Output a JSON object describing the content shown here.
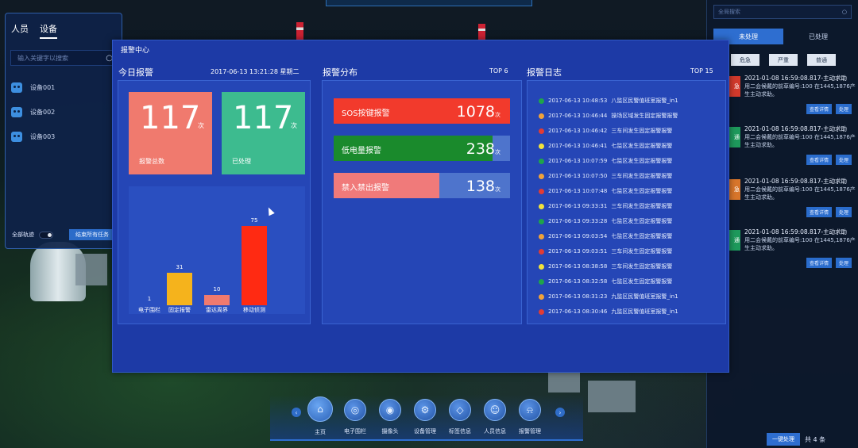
{
  "left_panel": {
    "tabs": [
      "人员",
      "设备"
    ],
    "search_placeholder": "输入关键字以搜索",
    "devices": [
      "设备001",
      "设备002",
      "设备003"
    ],
    "toggle_label": "全部轨迹",
    "end_task_btn": "结束所有任务"
  },
  "right_panel": {
    "search_placeholder": "全局搜索",
    "tabs": [
      "未处理",
      "已处理"
    ],
    "filters": [
      "危急",
      "严重",
      "普通"
    ],
    "items": [
      {
        "badge": "急",
        "badge_color": "#d33a2c",
        "title": "2021-01-08 16:59:08.817-主动求助",
        "desc1": "用二会候戴的前草编号:100 在1445,1876产",
        "desc2": "生主动求助。",
        "btn_detail": "查看详情",
        "btn_handle": "处理"
      },
      {
        "badge": "通",
        "badge_color": "#1e9a5c",
        "title": "2021-01-08 16:59:08.817-主动求助",
        "desc1": "用二会候戴的前草编号:100 在1445,1876产",
        "desc2": "生主动求助。",
        "btn_detail": "查看详情",
        "btn_handle": "处理"
      },
      {
        "badge": "急",
        "badge_color": "#d9762b",
        "title": "2021-01-08 16:59:08.817-主动求助",
        "desc1": "用二会候戴的前草编号:100 在1445,1876产",
        "desc2": "生主动求助。",
        "btn_detail": "查看详情",
        "btn_handle": "处理"
      },
      {
        "badge": "通",
        "badge_color": "#1e9a5c",
        "title": "2021-01-08 16:59:08.817-主动求助",
        "desc1": "用二会候戴的前草编号:100 在1445,1876产",
        "desc2": "生主动求助。",
        "btn_detail": "查看详情",
        "btn_handle": "处理"
      }
    ],
    "footer_btn": "一键处理",
    "footer_count": "共 4 条"
  },
  "modal": {
    "title": "报警中心",
    "today": {
      "heading": "今日报警",
      "datetime": "2017-06-13 13:21:28 星期二",
      "total": {
        "value": "117",
        "unit": "次",
        "label": "报警总数",
        "color": "#f07a6e"
      },
      "handled": {
        "value": "117",
        "unit": "次",
        "label": "已处理",
        "color": "#3dbb8f"
      }
    },
    "distribution": {
      "heading": "报警分布",
      "top": "TOP 6"
    },
    "log": {
      "heading": "报警日志",
      "top": "TOP 15",
      "entries": [
        {
          "time": "2017-06-13 10:48:53",
          "text": "八监区民警值班室报警_in1",
          "color": "#1fa44b"
        },
        {
          "time": "2017-06-13 10:46:44",
          "text": "操场区域发生固定报警报警",
          "color": "#f0a23a"
        },
        {
          "time": "2017-06-13 10:46:42",
          "text": "三车间发生固定报警报警",
          "color": "#e23c34"
        },
        {
          "time": "2017-06-13 10:46:41",
          "text": "七监区发生固定报警报警",
          "color": "#f2e23c"
        },
        {
          "time": "2017-06-13 10:07:59",
          "text": "七监区发生固定报警报警",
          "color": "#1fa44b"
        },
        {
          "time": "2017-06-13 10:07:50",
          "text": "三车间发生固定报警报警",
          "color": "#f0a23a"
        },
        {
          "time": "2017-06-13 10:07:48",
          "text": "七监区发生固定报警报警",
          "color": "#e23c34"
        },
        {
          "time": "2017-06-13 09:33:31",
          "text": "三车间发生固定报警报警",
          "color": "#f2e23c"
        },
        {
          "time": "2017-06-13 09:33:28",
          "text": "七监区发生固定报警报警",
          "color": "#1fa44b"
        },
        {
          "time": "2017-06-13 09:03:54",
          "text": "七监区发生固定报警报警",
          "color": "#f0a23a"
        },
        {
          "time": "2017-06-13 09:03:51",
          "text": "三车间发生固定报警报警",
          "color": "#e23c34"
        },
        {
          "time": "2017-06-13 08:38:58",
          "text": "三车间发生固定报警报警",
          "color": "#f2e23c"
        },
        {
          "time": "2017-06-13 08:32:58",
          "text": "七监区发生固定报警报警",
          "color": "#1fa44b"
        },
        {
          "time": "2017-06-13 08:31:23",
          "text": "九监区民警值班室报警_in1",
          "color": "#f0a23a"
        },
        {
          "time": "2017-06-13 08:30:46",
          "text": "九监区民警值班室报警_in1",
          "color": "#e23c34"
        }
      ]
    }
  },
  "chart_data": [
    {
      "type": "bar",
      "categories": [
        "电子围栏",
        "固定报警",
        "雷达周界",
        "移动侦测"
      ],
      "values": [
        1,
        31,
        10,
        75
      ],
      "colors": [
        "#7aa0ff",
        "#f5b31c",
        "#f07a6e",
        "#ff2a12"
      ],
      "ylim": [
        0,
        75
      ]
    },
    {
      "type": "bar",
      "orientation": "horizontal",
      "unit": "次",
      "categories": [
        "SOS按键报警",
        "低电量报警",
        "禁入禁出报警"
      ],
      "values": [
        1078,
        238,
        138
      ],
      "fill_fraction": [
        1.0,
        0.9,
        0.6
      ],
      "colors": [
        "#f23a2c",
        "#1a8a2c",
        "#f07a7a"
      ]
    }
  ],
  "bottom_nav": {
    "items": [
      {
        "label": "主页",
        "icon": "home-icon",
        "glyph": "⌂"
      },
      {
        "label": "电子围栏",
        "icon": "target-icon",
        "glyph": "◎"
      },
      {
        "label": "摄像头",
        "icon": "camera-icon",
        "glyph": "◉"
      },
      {
        "label": "设备管理",
        "icon": "gear-icon",
        "glyph": "⚙"
      },
      {
        "label": "标签信息",
        "icon": "tag-icon",
        "glyph": "◇"
      },
      {
        "label": "人员信息",
        "icon": "user-icon",
        "glyph": "☺"
      },
      {
        "label": "报警管理",
        "icon": "bell-icon",
        "glyph": "⍾"
      }
    ]
  }
}
